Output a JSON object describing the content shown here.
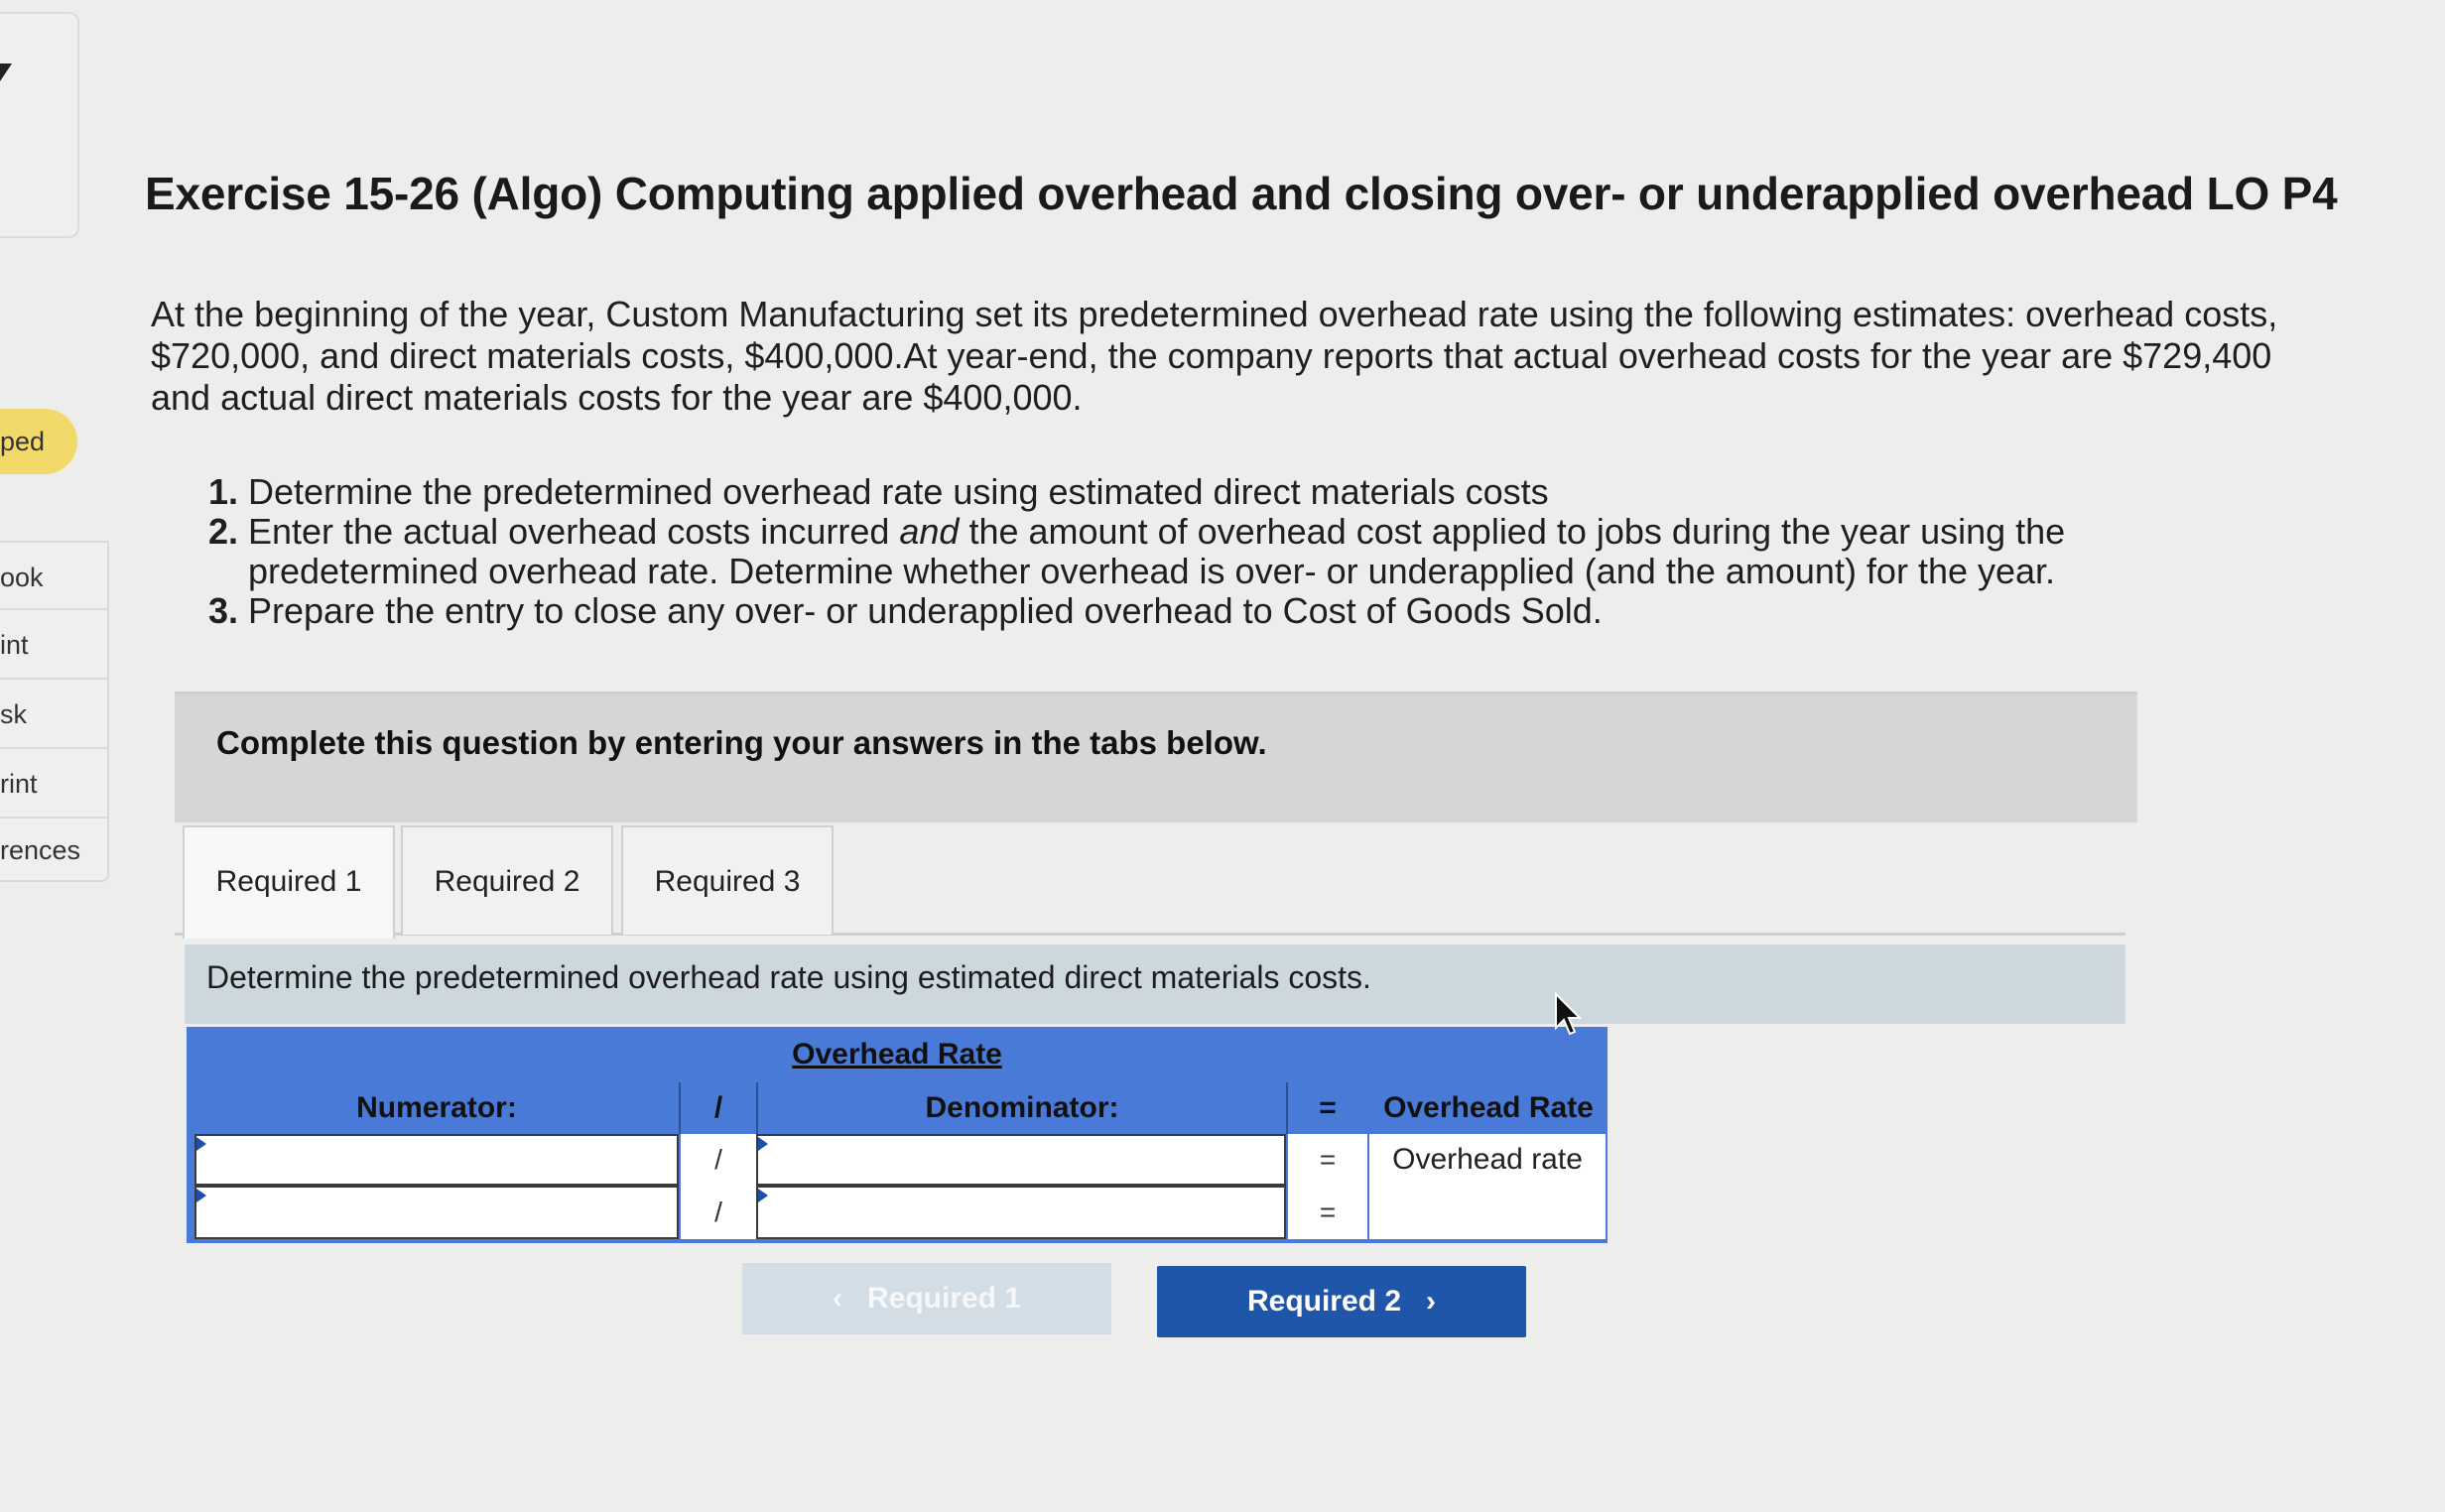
{
  "sidebar": {
    "badge": "ped",
    "items": [
      "ook",
      "int",
      "sk",
      "rint",
      "rences"
    ]
  },
  "title": "Exercise 15-26 (Algo) Computing applied overhead and closing over- or underapplied overhead LO P4",
  "intro": "At the beginning of the year, Custom Manufacturing set its predetermined overhead rate using the following estimates: overhead costs, $720,000, and direct materials costs, $400,000.At year-end, the company reports that actual overhead costs for the year are $729,400 and actual direct materials costs for the year are $400,000.",
  "tasks": [
    {
      "num": "1.",
      "text": "Determine the predetermined overhead rate using estimated direct materials costs"
    },
    {
      "num": "2.",
      "text_before": "Enter the actual overhead costs incurred ",
      "text_em": "and",
      "text_after": " the amount of overhead cost applied to jobs during the year using the predetermined overhead rate. Determine whether overhead is over- or underapplied (and the amount) for the year."
    },
    {
      "num": "3.",
      "text": "Prepare the entry to close any over- or underapplied overhead to Cost of Goods Sold."
    }
  ],
  "complete_bar": "Complete this question by entering your answers in the tabs below.",
  "tabs": [
    "Required 1",
    "Required 2",
    "Required 3"
  ],
  "instruction": "Determine the predetermined overhead rate using estimated direct materials costs.",
  "table": {
    "caption": "Overhead Rate",
    "headers": {
      "numerator": "Numerator:",
      "slash": "/",
      "denominator": "Denominator:",
      "equals": "=",
      "result": "Overhead Rate"
    },
    "rows": [
      {
        "numerator": "",
        "slash": "/",
        "denominator": "",
        "equals": "=",
        "result": "Overhead rate"
      },
      {
        "numerator": "",
        "slash": "/",
        "denominator": "",
        "equals": "=",
        "result": ""
      }
    ]
  },
  "nav": {
    "prev": "Required 1",
    "next": "Required 2"
  }
}
